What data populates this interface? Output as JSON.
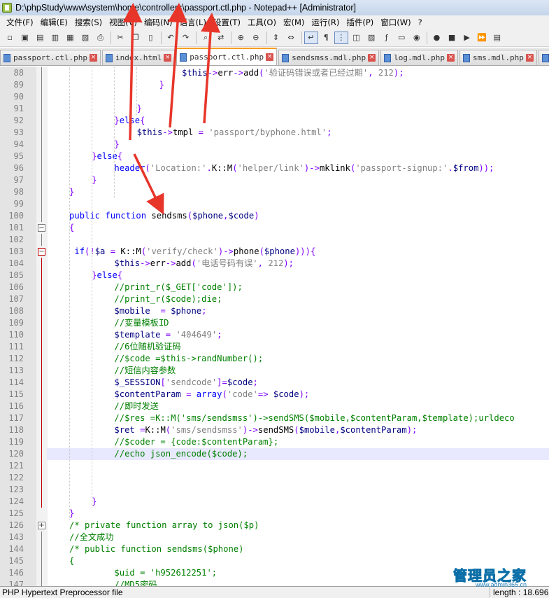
{
  "window": {
    "title": "D:\\phpStudy\\www\\system\\home\\controllers\\passport.ctl.php - Notepad++ [Administrator]"
  },
  "menu": {
    "items": [
      "文件(F)",
      "编辑(E)",
      "搜索(S)",
      "视图(V)",
      "编码(N)",
      "语言(L)",
      "设置(T)",
      "工具(O)",
      "宏(M)",
      "运行(R)",
      "插件(P)",
      "窗口(W)",
      "?"
    ]
  },
  "toolbar": {
    "buttons": [
      {
        "icon": "new-file-icon",
        "glyph": "▫"
      },
      {
        "icon": "open-file-icon",
        "glyph": "▣"
      },
      {
        "icon": "save-icon",
        "glyph": "▤"
      },
      {
        "icon": "save-all-icon",
        "glyph": "▥"
      },
      {
        "icon": "close-icon",
        "glyph": "▦"
      },
      {
        "icon": "close-all-icon",
        "glyph": "▧"
      },
      {
        "icon": "print-icon",
        "glyph": "⎙"
      },
      {
        "sep": true
      },
      {
        "icon": "cut-icon",
        "glyph": "✂"
      },
      {
        "icon": "copy-icon",
        "glyph": "❐"
      },
      {
        "icon": "paste-icon",
        "glyph": "▯"
      },
      {
        "sep": true
      },
      {
        "icon": "undo-icon",
        "glyph": "↶"
      },
      {
        "icon": "redo-icon",
        "glyph": "↷"
      },
      {
        "sep": true
      },
      {
        "icon": "find-icon",
        "glyph": "⌕"
      },
      {
        "icon": "replace-icon",
        "glyph": "⇄"
      },
      {
        "sep": true
      },
      {
        "icon": "zoom-in-icon",
        "glyph": "⊕"
      },
      {
        "icon": "zoom-out-icon",
        "glyph": "⊖"
      },
      {
        "sep": true
      },
      {
        "icon": "sync-vertical-icon",
        "glyph": "⇕"
      },
      {
        "icon": "sync-horizontal-icon",
        "glyph": "⇔"
      },
      {
        "sep": true
      },
      {
        "icon": "word-wrap-icon",
        "glyph": "↵",
        "active": true
      },
      {
        "icon": "show-all-chars-icon",
        "glyph": "¶"
      },
      {
        "icon": "indent-guide-icon",
        "glyph": "⋮",
        "active": true
      },
      {
        "icon": "udl-icon",
        "glyph": "◫"
      },
      {
        "icon": "doc-map-icon",
        "glyph": "▨"
      },
      {
        "icon": "function-list-icon",
        "glyph": "ƒ"
      },
      {
        "icon": "folder-workspace-icon",
        "glyph": "▭"
      },
      {
        "icon": "monitor-icon",
        "glyph": "◉"
      },
      {
        "sep": true
      },
      {
        "icon": "record-macro-icon",
        "glyph": "●"
      },
      {
        "icon": "stop-macro-icon",
        "glyph": "■"
      },
      {
        "icon": "play-macro-icon",
        "glyph": "▶"
      },
      {
        "icon": "run-macro-multiple-icon",
        "glyph": "⏩"
      },
      {
        "icon": "save-macro-icon",
        "glyph": "▤"
      }
    ]
  },
  "tabs": [
    {
      "label": "passport.ctl.php",
      "active": false
    },
    {
      "label": "index.html",
      "active": false
    },
    {
      "label": "passport.ctl.php",
      "active": true
    },
    {
      "label": "sendsmss.mdl.php",
      "active": false
    },
    {
      "label": "log.mdl.php",
      "active": false
    },
    {
      "label": "sms.mdl.php",
      "active": false
    },
    {
      "label": "reg.htm",
      "active": false
    }
  ],
  "code_lines": [
    {
      "n": "88",
      "indent": 6,
      "code": [
        [
          "var",
          "$this"
        ],
        [
          "op",
          "->"
        ],
        [
          "fn",
          "err"
        ],
        [
          "op",
          "->"
        ],
        [
          "fn",
          "add"
        ],
        [
          "op",
          "("
        ],
        [
          "str",
          "'验证码错误或者已经过期'"
        ],
        [
          "op",
          ", "
        ],
        [
          "str",
          "212"
        ],
        [
          "op",
          ");"
        ]
      ]
    },
    {
      "n": "89",
      "indent": 5,
      "code": [
        [
          "op",
          "}"
        ]
      ]
    },
    {
      "n": "90",
      "indent": 0,
      "code": []
    },
    {
      "n": "91",
      "indent": 4,
      "code": [
        [
          "op",
          "}"
        ]
      ]
    },
    {
      "n": "92",
      "indent": 3,
      "code": [
        [
          "op",
          "}"
        ],
        [
          "kw",
          "else"
        ],
        [
          "op",
          "{"
        ]
      ]
    },
    {
      "n": "93",
      "indent": 4,
      "code": [
        [
          "var",
          "$this"
        ],
        [
          "op",
          "->"
        ],
        [
          "fn",
          "tmpl"
        ],
        [
          "op",
          " = "
        ],
        [
          "str",
          "'passport/byphone.html'"
        ],
        [
          "op",
          ";"
        ]
      ]
    },
    {
      "n": "94",
      "indent": 3,
      "code": [
        [
          "op",
          "}"
        ]
      ]
    },
    {
      "n": "95",
      "indent": 2,
      "code": [
        [
          "op",
          "}"
        ],
        [
          "kw",
          "else"
        ],
        [
          "op",
          "{"
        ]
      ]
    },
    {
      "n": "96",
      "indent": 3,
      "code": [
        [
          "kw",
          "header"
        ],
        [
          "op",
          "("
        ],
        [
          "str",
          "'Location:'"
        ],
        [
          "op",
          "."
        ],
        [
          "fn",
          "K::M"
        ],
        [
          "op",
          "("
        ],
        [
          "str",
          "'helper/link'"
        ],
        [
          "op",
          ")->"
        ],
        [
          "fn",
          "mklink"
        ],
        [
          "op",
          "("
        ],
        [
          "str",
          "'passport-signup:'"
        ],
        [
          "op",
          "."
        ],
        [
          "var",
          "$from"
        ],
        [
          "op",
          "));"
        ]
      ]
    },
    {
      "n": "97",
      "indent": 2,
      "code": [
        [
          "op",
          "}"
        ]
      ]
    },
    {
      "n": "98",
      "indent": 1,
      "code": [
        [
          "op",
          "}"
        ]
      ]
    },
    {
      "n": "99",
      "indent": 0,
      "code": []
    },
    {
      "n": "100",
      "indent": 1,
      "code": [
        [
          "kw",
          "public function "
        ],
        [
          "fn",
          "sendsms"
        ],
        [
          "op",
          "("
        ],
        [
          "var",
          "$phone"
        ],
        [
          "op",
          ","
        ],
        [
          "var",
          "$code"
        ],
        [
          "op",
          ")"
        ]
      ]
    },
    {
      "n": "101",
      "indent": 1,
      "code": [
        [
          "op",
          "{"
        ]
      ]
    },
    {
      "n": "102",
      "indent": 0,
      "code": []
    },
    {
      "n": "103",
      "indent": 1,
      "pre": " ",
      "code": [
        [
          "kw",
          "if"
        ],
        [
          "op",
          "(!"
        ],
        [
          "var",
          "$a"
        ],
        [
          "op",
          " = "
        ],
        [
          "fn",
          "K::M"
        ],
        [
          "op",
          "("
        ],
        [
          "str",
          "'verify/check'"
        ],
        [
          "op",
          ")->"
        ],
        [
          "fn",
          "phone"
        ],
        [
          "op",
          "("
        ],
        [
          "var",
          "$phone"
        ],
        [
          "op",
          "))){"
        ]
      ]
    },
    {
      "n": "104",
      "indent": 3,
      "code": [
        [
          "var",
          "$this"
        ],
        [
          "op",
          "->"
        ],
        [
          "fn",
          "err"
        ],
        [
          "op",
          "->"
        ],
        [
          "fn",
          "add"
        ],
        [
          "op",
          "("
        ],
        [
          "str",
          "'电话号码有误'"
        ],
        [
          "op",
          ", "
        ],
        [
          "str",
          "212"
        ],
        [
          "op",
          ");"
        ]
      ]
    },
    {
      "n": "105",
      "indent": 2,
      "code": [
        [
          "op",
          "}"
        ],
        [
          "kw",
          "else"
        ],
        [
          "op",
          "{"
        ]
      ]
    },
    {
      "n": "106",
      "indent": 3,
      "code": [
        [
          "cm",
          "//print_r($_GET['code']);"
        ]
      ]
    },
    {
      "n": "107",
      "indent": 3,
      "code": [
        [
          "cm",
          "//print_r($code);die;"
        ]
      ]
    },
    {
      "n": "108",
      "indent": 3,
      "code": [
        [
          "var",
          "$mobile"
        ],
        [
          "op",
          "  = "
        ],
        [
          "var",
          "$phone"
        ],
        [
          "op",
          ";"
        ]
      ]
    },
    {
      "n": "109",
      "indent": 3,
      "code": [
        [
          "cm",
          "//变量模板ID"
        ]
      ]
    },
    {
      "n": "110",
      "indent": 3,
      "code": [
        [
          "var",
          "$template"
        ],
        [
          "op",
          " = "
        ],
        [
          "str",
          "'404649'"
        ],
        [
          "op",
          ";"
        ]
      ]
    },
    {
      "n": "111",
      "indent": 3,
      "code": [
        [
          "cm",
          "//6位随机验证码"
        ]
      ]
    },
    {
      "n": "112",
      "indent": 3,
      "code": [
        [
          "cm",
          "//$code =$this->randNumber();"
        ]
      ]
    },
    {
      "n": "113",
      "indent": 3,
      "code": [
        [
          "cm",
          "//短信内容参数"
        ]
      ]
    },
    {
      "n": "114",
      "indent": 3,
      "code": [
        [
          "var",
          "$_SESSION"
        ],
        [
          "op",
          "["
        ],
        [
          "str",
          "'sendcode'"
        ],
        [
          "op",
          "]="
        ],
        [
          "var",
          "$code"
        ],
        [
          "op",
          ";"
        ]
      ]
    },
    {
      "n": "115",
      "indent": 3,
      "code": [
        [
          "var",
          "$contentParam"
        ],
        [
          "op",
          " = "
        ],
        [
          "kw",
          "array"
        ],
        [
          "op",
          "("
        ],
        [
          "str",
          "'code'"
        ],
        [
          "op",
          "=> "
        ],
        [
          "var",
          "$code"
        ],
        [
          "op",
          ");"
        ]
      ]
    },
    {
      "n": "116",
      "indent": 3,
      "code": [
        [
          "cm",
          "//即时发送"
        ]
      ]
    },
    {
      "n": "117",
      "indent": 3,
      "code": [
        [
          "cm",
          "//$res =K::M('sms/sendsmss')->sendSMS($mobile,$contentParam,$template);urldeco"
        ]
      ]
    },
    {
      "n": "118",
      "indent": 3,
      "code": [
        [
          "var",
          "$ret"
        ],
        [
          "op",
          " ="
        ],
        [
          "fn",
          "K::M"
        ],
        [
          "op",
          "("
        ],
        [
          "str",
          "'sms/sendsmss'"
        ],
        [
          "op",
          ")->"
        ],
        [
          "fn",
          "sendSMS"
        ],
        [
          "op",
          "("
        ],
        [
          "var",
          "$mobile"
        ],
        [
          "op",
          ","
        ],
        [
          "var",
          "$contentParam"
        ],
        [
          "op",
          ");"
        ]
      ]
    },
    {
      "n": "119",
      "indent": 3,
      "code": [
        [
          "cm",
          "//$coder = {code:$contentParam};"
        ]
      ]
    },
    {
      "n": "120",
      "indent": 3,
      "current": true,
      "code": [
        [
          "cm",
          "//echo json_encode($code);"
        ]
      ]
    },
    {
      "n": "121",
      "indent": 0,
      "code": []
    },
    {
      "n": "122",
      "indent": 0,
      "code": []
    },
    {
      "n": "123",
      "indent": 0,
      "code": []
    },
    {
      "n": "124",
      "indent": 2,
      "code": [
        [
          "op",
          "}"
        ]
      ]
    },
    {
      "n": "125",
      "indent": 1,
      "code": [
        [
          "op",
          "}"
        ]
      ]
    },
    {
      "n": "126",
      "indent": 1,
      "code": [
        [
          "cm",
          "/* private function array to json($p)"
        ]
      ]
    },
    {
      "n": "143",
      "indent": 1,
      "code": [
        [
          "cm",
          "//全文成功"
        ]
      ]
    },
    {
      "n": "144",
      "indent": 1,
      "code": [
        [
          "cm",
          "/* public function sendsms($phone)"
        ]
      ]
    },
    {
      "n": "145",
      "indent": 1,
      "code": [
        [
          "cm",
          "{"
        ]
      ]
    },
    {
      "n": "146",
      "indent": 3,
      "code": [
        [
          "cm",
          "$uid = 'h952612251';"
        ]
      ]
    },
    {
      "n": "147",
      "indent": 3,
      "code": [
        [
          "cm",
          "//MD5密码"
        ]
      ]
    }
  ],
  "statusbar": {
    "file_type": "PHP Hypertext Preprocessor file",
    "length": "length : 18.696"
  },
  "watermark": {
    "text": "管理员之家",
    "url": "www.admin365.cn"
  },
  "colors": {
    "keyword": "#0000ff",
    "string": "#808080",
    "variable": "#000080",
    "comment": "#008000",
    "operator": "#8000ff",
    "annotation_arrow": "#e8352a",
    "active_tab_accent": "#f59d22"
  }
}
